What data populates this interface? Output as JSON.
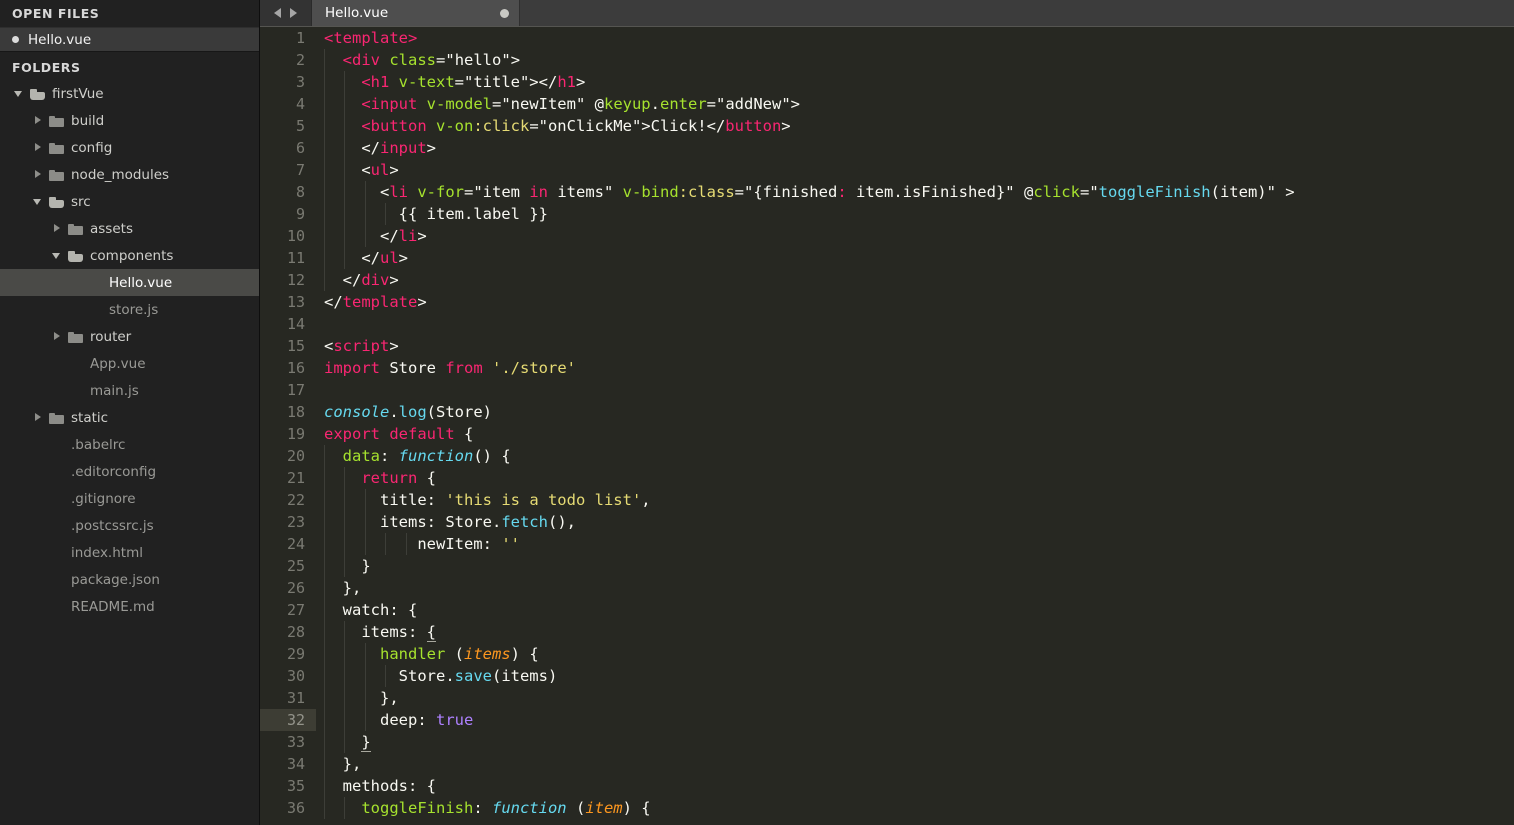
{
  "sidebar": {
    "open_files_header": "OPEN FILES",
    "open_files": [
      {
        "name": "Hello.vue",
        "modified": true,
        "selected": true,
        "icon": "dot-icon"
      }
    ],
    "folders_header": "FOLDERS",
    "tree": [
      {
        "label": "firstVue",
        "depth": 0,
        "type": "folder",
        "state": "open",
        "icon": "folder-open-icon",
        "selected": false
      },
      {
        "label": "build",
        "depth": 1,
        "type": "folder",
        "state": "closed",
        "icon": "folder-closed-icon",
        "selected": false
      },
      {
        "label": "config",
        "depth": 1,
        "type": "folder",
        "state": "closed",
        "icon": "folder-closed-icon",
        "selected": false
      },
      {
        "label": "node_modules",
        "depth": 1,
        "type": "folder",
        "state": "closed",
        "icon": "folder-closed-icon",
        "selected": false
      },
      {
        "label": "src",
        "depth": 1,
        "type": "folder",
        "state": "open",
        "icon": "folder-open-icon",
        "selected": false
      },
      {
        "label": "assets",
        "depth": 2,
        "type": "folder",
        "state": "closed",
        "icon": "folder-closed-icon",
        "selected": false
      },
      {
        "label": "components",
        "depth": 2,
        "type": "folder",
        "state": "open",
        "icon": "folder-open-icon",
        "selected": false
      },
      {
        "label": "Hello.vue",
        "depth": 3,
        "type": "file",
        "state": "none",
        "icon": "file-icon",
        "selected": true
      },
      {
        "label": "store.js",
        "depth": 3,
        "type": "file",
        "state": "none",
        "icon": "file-icon",
        "selected": false
      },
      {
        "label": "router",
        "depth": 2,
        "type": "folder",
        "state": "closed",
        "icon": "folder-closed-icon",
        "selected": false
      },
      {
        "label": "App.vue",
        "depth": 2,
        "type": "file",
        "state": "none",
        "icon": "file-icon",
        "selected": false
      },
      {
        "label": "main.js",
        "depth": 2,
        "type": "file",
        "state": "none",
        "icon": "file-icon",
        "selected": false
      },
      {
        "label": "static",
        "depth": 1,
        "type": "folder",
        "state": "closed",
        "icon": "folder-closed-icon",
        "selected": false
      },
      {
        "label": ".babelrc",
        "depth": 1,
        "type": "file",
        "state": "none",
        "icon": "file-icon",
        "selected": false
      },
      {
        "label": ".editorconfig",
        "depth": 1,
        "type": "file",
        "state": "none",
        "icon": "file-icon",
        "selected": false
      },
      {
        "label": ".gitignore",
        "depth": 1,
        "type": "file",
        "state": "none",
        "icon": "file-icon",
        "selected": false
      },
      {
        "label": ".postcssrc.js",
        "depth": 1,
        "type": "file",
        "state": "none",
        "icon": "file-icon",
        "selected": false
      },
      {
        "label": "index.html",
        "depth": 1,
        "type": "file",
        "state": "none",
        "icon": "file-icon",
        "selected": false
      },
      {
        "label": "package.json",
        "depth": 1,
        "type": "file",
        "state": "none",
        "icon": "file-icon",
        "selected": false
      },
      {
        "label": "README.md",
        "depth": 1,
        "type": "file",
        "state": "none",
        "icon": "file-icon",
        "selected": false
      }
    ]
  },
  "tabbar": {
    "prev_icon": "arrow-left-icon",
    "next_icon": "arrow-right-icon",
    "tabs": [
      {
        "label": "Hello.vue",
        "dirty": true,
        "active": true,
        "dirty_icon": "unsaved-dot-icon"
      }
    ]
  },
  "editor": {
    "active_line": 32,
    "total_visible_lines": 36,
    "colors": {
      "background": "#272822",
      "sidebar_background": "#212121",
      "gutter_text": "#7a7a72",
      "active_line_gutter": "#3d3d34",
      "tag": "#f92672",
      "attribute": "#a6e22e",
      "string": "#e6db74",
      "function": "#66d9ef",
      "constant": "#ae81ff",
      "parameter": "#fd971f",
      "plain": "#f8f8f2",
      "indent_guide": "#3d3e38",
      "selection": "#4a4a47"
    },
    "lines": [
      {
        "n": 1,
        "indent": 0,
        "tokens": [
          {
            "t": "tag",
            "v": "<template>"
          }
        ]
      },
      {
        "n": 2,
        "indent": 1,
        "tokens": [
          {
            "t": "plain",
            "v": "  "
          },
          {
            "t": "tag",
            "v": "<div "
          },
          {
            "t": "attr",
            "v": "class"
          },
          {
            "t": "plain",
            "v": "="
          },
          {
            "t": "plain",
            "v": "\"hello\""
          },
          {
            "t": "plain",
            "v": ">"
          }
        ]
      },
      {
        "n": 3,
        "indent": 2,
        "tokens": [
          {
            "t": "plain",
            "v": "    "
          },
          {
            "t": "tag",
            "v": "<h1 "
          },
          {
            "t": "attr",
            "v": "v-text"
          },
          {
            "t": "plain",
            "v": "=\"title\"></"
          },
          {
            "t": "tag",
            "v": "h1"
          },
          {
            "t": "plain",
            "v": ">"
          }
        ]
      },
      {
        "n": 4,
        "indent": 2,
        "tokens": [
          {
            "t": "plain",
            "v": "    "
          },
          {
            "t": "tag",
            "v": "<input "
          },
          {
            "t": "attr",
            "v": "v-model"
          },
          {
            "t": "plain",
            "v": "=\"newItem\" "
          },
          {
            "t": "plain",
            "v": "@"
          },
          {
            "t": "attr",
            "v": "keyup"
          },
          {
            "t": "plain",
            "v": "."
          },
          {
            "t": "attr",
            "v": "enter"
          },
          {
            "t": "plain",
            "v": "=\"addNew\">"
          }
        ]
      },
      {
        "n": 5,
        "indent": 2,
        "tokens": [
          {
            "t": "plain",
            "v": "    "
          },
          {
            "t": "tag",
            "v": "<button "
          },
          {
            "t": "attr",
            "v": "v-on"
          },
          {
            "t": "gold",
            "v": ":click"
          },
          {
            "t": "plain",
            "v": "=\"onClickMe\">Click!</"
          },
          {
            "t": "tag",
            "v": "button"
          },
          {
            "t": "plain",
            "v": ">"
          }
        ]
      },
      {
        "n": 6,
        "indent": 2,
        "tokens": [
          {
            "t": "plain",
            "v": "    </"
          },
          {
            "t": "tag",
            "v": "input"
          },
          {
            "t": "plain",
            "v": ">"
          }
        ]
      },
      {
        "n": 7,
        "indent": 2,
        "tokens": [
          {
            "t": "plain",
            "v": "    <"
          },
          {
            "t": "tag",
            "v": "ul"
          },
          {
            "t": "plain",
            "v": ">"
          }
        ]
      },
      {
        "n": 8,
        "indent": 3,
        "tokens": [
          {
            "t": "plain",
            "v": "      <"
          },
          {
            "t": "tag",
            "v": "li "
          },
          {
            "t": "attr",
            "v": "v-for"
          },
          {
            "t": "plain",
            "v": "=\"item "
          },
          {
            "t": "kw",
            "v": "in"
          },
          {
            "t": "plain",
            "v": " items\" "
          },
          {
            "t": "attr",
            "v": "v-bind"
          },
          {
            "t": "gold",
            "v": ":class"
          },
          {
            "t": "plain",
            "v": "=\"{finished"
          },
          {
            "t": "tag",
            "v": ":"
          },
          {
            "t": "plain",
            "v": " item.isFinished}\" "
          },
          {
            "t": "plain",
            "v": "@"
          },
          {
            "t": "attr",
            "v": "click"
          },
          {
            "t": "plain",
            "v": "=\""
          },
          {
            "t": "fnc",
            "v": "toggleFinish"
          },
          {
            "t": "plain",
            "v": "(item)\" >"
          }
        ]
      },
      {
        "n": 9,
        "indent": 4,
        "tokens": [
          {
            "t": "plain",
            "v": "        {{ item.label }}"
          }
        ]
      },
      {
        "n": 10,
        "indent": 3,
        "tokens": [
          {
            "t": "plain",
            "v": "      </"
          },
          {
            "t": "tag",
            "v": "li"
          },
          {
            "t": "plain",
            "v": ">"
          }
        ]
      },
      {
        "n": 11,
        "indent": 2,
        "tokens": [
          {
            "t": "plain",
            "v": "    </"
          },
          {
            "t": "tag",
            "v": "ul"
          },
          {
            "t": "plain",
            "v": ">"
          }
        ]
      },
      {
        "n": 12,
        "indent": 1,
        "tokens": [
          {
            "t": "plain",
            "v": "  </"
          },
          {
            "t": "tag",
            "v": "div"
          },
          {
            "t": "plain",
            "v": ">"
          }
        ]
      },
      {
        "n": 13,
        "indent": 0,
        "tokens": [
          {
            "t": "plain",
            "v": "</"
          },
          {
            "t": "tag",
            "v": "template"
          },
          {
            "t": "plain",
            "v": ">"
          }
        ]
      },
      {
        "n": 14,
        "indent": 0,
        "tokens": []
      },
      {
        "n": 15,
        "indent": 0,
        "tokens": [
          {
            "t": "plain",
            "v": "<"
          },
          {
            "t": "tag",
            "v": "script"
          },
          {
            "t": "plain",
            "v": ">"
          }
        ]
      },
      {
        "n": 16,
        "indent": 0,
        "tokens": [
          {
            "t": "kw",
            "v": "import"
          },
          {
            "t": "plain",
            "v": " Store "
          },
          {
            "t": "kw",
            "v": "from"
          },
          {
            "t": "plain",
            "v": " "
          },
          {
            "t": "str",
            "v": "'./store'"
          }
        ]
      },
      {
        "n": 17,
        "indent": 0,
        "tokens": []
      },
      {
        "n": 18,
        "indent": 0,
        "tokens": [
          {
            "t": "cls",
            "v": "console"
          },
          {
            "t": "plain",
            "v": "."
          },
          {
            "t": "fnc",
            "v": "log"
          },
          {
            "t": "plain",
            "v": "(Store)"
          }
        ]
      },
      {
        "n": 19,
        "indent": 0,
        "tokens": [
          {
            "t": "kw",
            "v": "export default"
          },
          {
            "t": "plain",
            "v": " {"
          }
        ]
      },
      {
        "n": 20,
        "indent": 1,
        "tokens": [
          {
            "t": "plain",
            "v": "  "
          },
          {
            "t": "attr",
            "v": "data"
          },
          {
            "t": "plain",
            "v": ": "
          },
          {
            "t": "fn",
            "v": "function"
          },
          {
            "t": "plain",
            "v": "() {"
          }
        ]
      },
      {
        "n": 21,
        "indent": 2,
        "tokens": [
          {
            "t": "plain",
            "v": "    "
          },
          {
            "t": "kw",
            "v": "return"
          },
          {
            "t": "plain",
            "v": " {"
          }
        ]
      },
      {
        "n": 22,
        "indent": 3,
        "tokens": [
          {
            "t": "plain",
            "v": "      title: "
          },
          {
            "t": "str",
            "v": "'this is a todo list'"
          },
          {
            "t": "plain",
            "v": ","
          }
        ]
      },
      {
        "n": 23,
        "indent": 3,
        "tokens": [
          {
            "t": "plain",
            "v": "      items: Store."
          },
          {
            "t": "fnc",
            "v": "fetch"
          },
          {
            "t": "plain",
            "v": "(),"
          }
        ]
      },
      {
        "n": 24,
        "indent": 5,
        "tokens": [
          {
            "t": "plain",
            "v": "          newItem: "
          },
          {
            "t": "str",
            "v": "''"
          }
        ]
      },
      {
        "n": 25,
        "indent": 2,
        "tokens": [
          {
            "t": "plain",
            "v": "    }"
          }
        ]
      },
      {
        "n": 26,
        "indent": 1,
        "tokens": [
          {
            "t": "plain",
            "v": "  },"
          }
        ]
      },
      {
        "n": 27,
        "indent": 1,
        "tokens": [
          {
            "t": "plain",
            "v": "  watch: {"
          }
        ]
      },
      {
        "n": 28,
        "indent": 2,
        "tokens": [
          {
            "t": "plain",
            "v": "    items: "
          },
          {
            "t": "bmatch",
            "v": "{"
          }
        ]
      },
      {
        "n": 29,
        "indent": 3,
        "tokens": [
          {
            "t": "plain",
            "v": "      "
          },
          {
            "t": "attr",
            "v": "handler"
          },
          {
            "t": "plain",
            "v": " ("
          },
          {
            "t": "param",
            "v": "items"
          },
          {
            "t": "plain",
            "v": ") {"
          }
        ]
      },
      {
        "n": 30,
        "indent": 4,
        "tokens": [
          {
            "t": "plain",
            "v": "        Store."
          },
          {
            "t": "fnc",
            "v": "save"
          },
          {
            "t": "plain",
            "v": "(items)"
          }
        ]
      },
      {
        "n": 31,
        "indent": 3,
        "tokens": [
          {
            "t": "plain",
            "v": "      },"
          }
        ]
      },
      {
        "n": 32,
        "indent": 3,
        "tokens": [
          {
            "t": "plain",
            "v": "      deep: "
          },
          {
            "t": "num",
            "v": "true"
          }
        ]
      },
      {
        "n": 33,
        "indent": 2,
        "tokens": [
          {
            "t": "plain",
            "v": "    "
          },
          {
            "t": "bmatch",
            "v": "}"
          }
        ]
      },
      {
        "n": 34,
        "indent": 1,
        "tokens": [
          {
            "t": "plain",
            "v": "  },"
          }
        ]
      },
      {
        "n": 35,
        "indent": 1,
        "tokens": [
          {
            "t": "plain",
            "v": "  methods: {"
          }
        ]
      },
      {
        "n": 36,
        "indent": 2,
        "tokens": [
          {
            "t": "plain",
            "v": "    "
          },
          {
            "t": "attr",
            "v": "toggleFinish"
          },
          {
            "t": "plain",
            "v": ": "
          },
          {
            "t": "fn",
            "v": "function"
          },
          {
            "t": "plain",
            "v": " ("
          },
          {
            "t": "param",
            "v": "item"
          },
          {
            "t": "plain",
            "v": ") {"
          }
        ]
      }
    ]
  }
}
